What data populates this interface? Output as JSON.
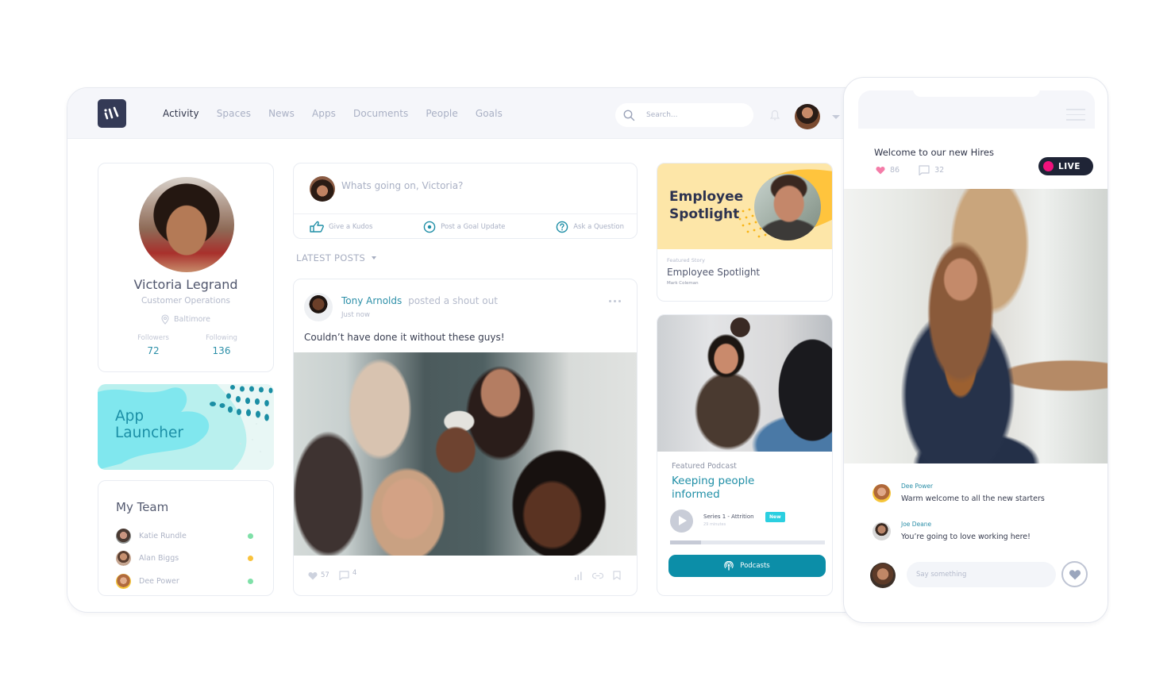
{
  "app": {
    "nav": [
      {
        "label": "Activity",
        "active": true
      },
      {
        "label": "Spaces",
        "active": false
      },
      {
        "label": "News",
        "active": false
      },
      {
        "label": "Apps",
        "active": false
      },
      {
        "label": "Documents",
        "active": false
      },
      {
        "label": "People",
        "active": false
      },
      {
        "label": "Goals",
        "active": false
      }
    ],
    "search": {
      "placeholder": "Search..."
    },
    "icons": {
      "logo": "brand-logo-icon",
      "search": "search-icon",
      "bell": "bell-icon",
      "caret": "chevron-down-icon"
    }
  },
  "profile": {
    "name": "Victoria Legrand",
    "department": "Customer Operations",
    "location": "Baltimore",
    "followers_label": "Followers",
    "followers": "72",
    "following_label": "Following",
    "following": "136"
  },
  "launcher": {
    "title_line1": "App",
    "title_line2": "Launcher"
  },
  "team": {
    "title": "My Team",
    "members": [
      {
        "name": "Katie Rundle",
        "status_color": "#7fe0a8"
      },
      {
        "name": "Alan Biggs",
        "status_color": "#f9c23c"
      },
      {
        "name": "Dee Power",
        "status_color": "#7fe0a8"
      }
    ]
  },
  "composer": {
    "placeholder": "Whats going on, Victoria?",
    "actions": [
      {
        "label": "Give a Kudos",
        "icon": "thumbs-up-icon"
      },
      {
        "label": "Post a Goal Update",
        "icon": "target-icon"
      },
      {
        "label": "Ask a Question",
        "icon": "question-icon"
      }
    ]
  },
  "feed": {
    "filter_label": "LATEST POSTS"
  },
  "post": {
    "author": "Tony Arnolds",
    "action": "posted a shout out",
    "time": "Just now",
    "text": "Couldn’t have done it without these guys!",
    "likes": "57",
    "comments": "4"
  },
  "spotlight": {
    "banner_line1": "Employee",
    "banner_line2": "Spotlight",
    "kicker": "Featured Story",
    "heading": "Employee Spotlight",
    "author": "Mark Coleman"
  },
  "podcast": {
    "kicker": "Featured Podcast",
    "title_line1": "Keeping people",
    "title_line2": "informed",
    "episode": "Series 1 - Attrition",
    "duration": "29 minutes",
    "badge": "New",
    "progress_percent": 20,
    "button_label": "Podcasts"
  },
  "phone": {
    "title": "Welcome to our new Hires",
    "likes": "86",
    "comments": "32",
    "live_label": "LIVE",
    "comment_list": [
      {
        "name": "Dee Power",
        "text": "Warm welcome to all the new starters"
      },
      {
        "name": "Joe Deane",
        "text": "You’re going to love working here!"
      }
    ],
    "say_placeholder": "Say something"
  },
  "colors": {
    "accent": "#1e8ea6",
    "nav_dark": "#343a56",
    "live_pink": "#f0127c",
    "badge_cyan": "#2bcfe0",
    "spotlight_yellow": "#fde6a8",
    "launcher_cyan": "#b9f0ee"
  }
}
